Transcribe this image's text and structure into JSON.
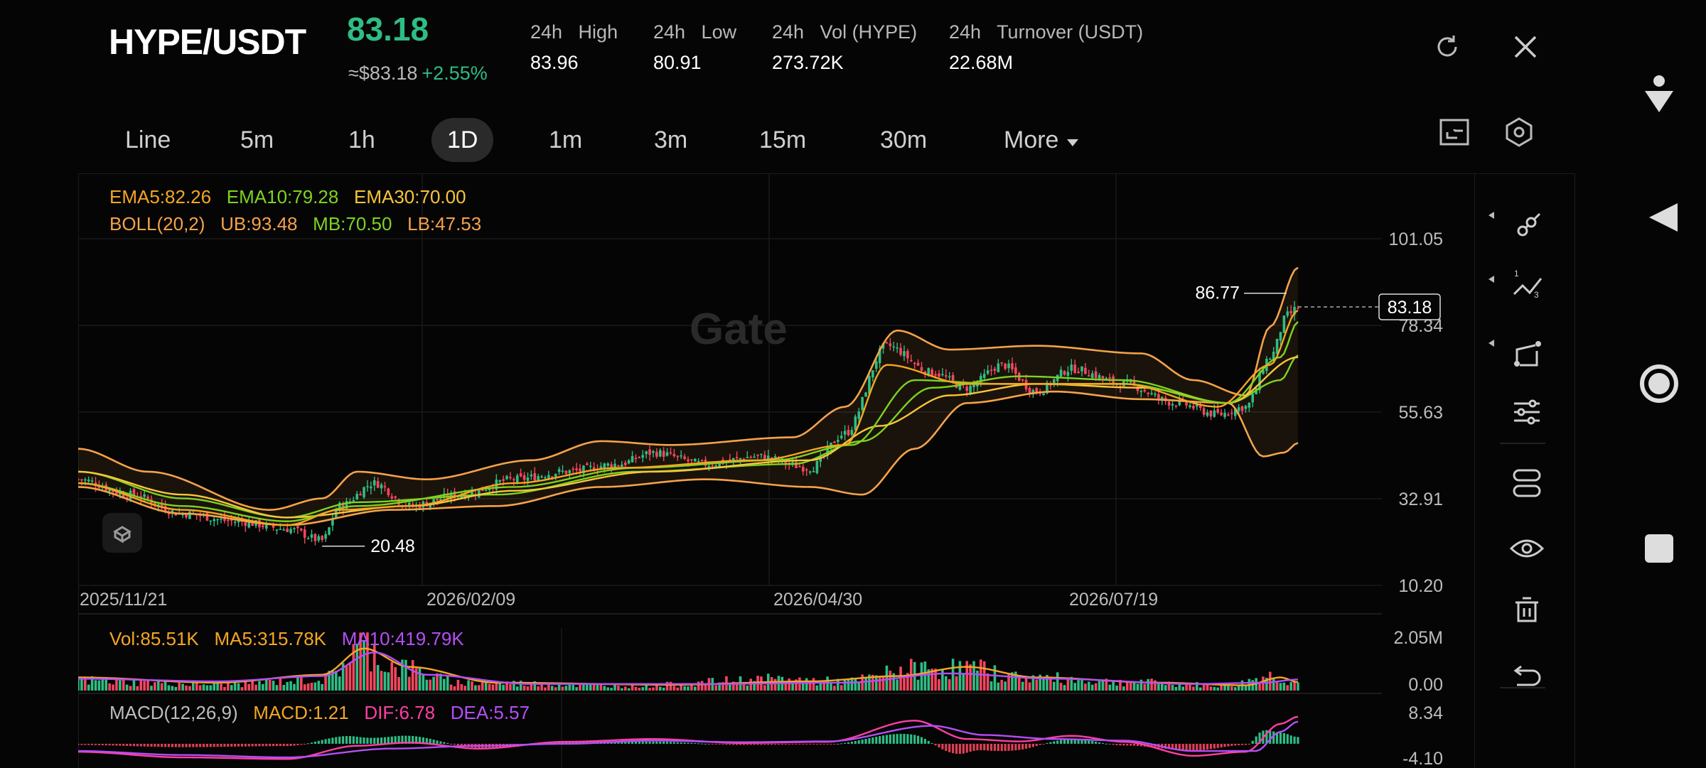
{
  "header": {
    "symbol": "HYPE/USDT",
    "last_price": "83.18",
    "approx_usd": "≈$83.18",
    "change_pct": "+2.55%",
    "stats": [
      {
        "label": "24h   High",
        "value": "83.96"
      },
      {
        "label": "24h   Low",
        "value": "80.91"
      },
      {
        "label": "24h   Vol (HYPE)",
        "value": "273.72K"
      },
      {
        "label": "24h   Turnover (USDT)",
        "value": "22.68M"
      }
    ],
    "icons": {
      "refresh": "refresh-icon",
      "close": "close-icon"
    }
  },
  "timeframes": [
    "Line",
    "5m",
    "1h",
    "1D",
    "1m",
    "3m",
    "15m",
    "30m"
  ],
  "selected_timeframe": "1D",
  "more_label": "More",
  "watermark": "Gate",
  "indicators": {
    "ema": [
      "EMA5:82.26",
      "EMA10:79.28",
      "EMA30:70.00"
    ],
    "boll": [
      "BOLL(20,2)",
      "UB:93.48",
      "MB:70.50",
      "LB:47.53"
    ],
    "vol": [
      "Vol:85.51K",
      "MA5:315.78K",
      "MA10:419.79K"
    ],
    "macd": [
      "MACD(12,26,9)",
      "MACD:1.21",
      "DIF:6.78",
      "DEA:5.57"
    ]
  },
  "colors": {
    "up": "#2ebd85",
    "down": "#f6465d",
    "ema5": "#f5a623",
    "ema10": "#7ed321",
    "ema30": "#f8c53a",
    "boll": "#f5a24a",
    "ma10": "#b44ef7",
    "dif": "#ff3fa4",
    "dea": "#b44ef7"
  },
  "chart_data": [
    {
      "type": "candlestick",
      "title": "HYPE/USDT 1D",
      "x_dates": [
        "2025/11/21",
        "2026/02/09",
        "2026/04/30",
        "2026/07/19"
      ],
      "y_ticks": [
        "101.05",
        "78.34",
        "55.63",
        "32.91",
        "10.20"
      ],
      "ylim": [
        10.2,
        101.05
      ],
      "last_price_label": "83.18",
      "annotations": {
        "high": "86.77",
        "low": "20.48"
      },
      "close_anchors": [
        [
          0,
          38
        ],
        [
          15,
          34
        ],
        [
          30,
          29
        ],
        [
          45,
          27
        ],
        [
          60,
          25
        ],
        [
          70,
          22
        ],
        [
          75,
          31
        ],
        [
          85,
          37
        ],
        [
          95,
          31
        ],
        [
          110,
          34
        ],
        [
          125,
          38
        ],
        [
          140,
          40
        ],
        [
          155,
          42
        ],
        [
          165,
          45
        ],
        [
          180,
          42
        ],
        [
          195,
          44
        ],
        [
          210,
          41
        ],
        [
          220,
          50
        ],
        [
          232,
          73
        ],
        [
          245,
          66
        ],
        [
          255,
          62
        ],
        [
          265,
          68
        ],
        [
          275,
          61
        ],
        [
          285,
          67
        ],
        [
          300,
          63
        ],
        [
          315,
          58
        ],
        [
          327,
          55
        ],
        [
          335,
          57
        ],
        [
          342,
          70
        ],
        [
          347,
          81
        ],
        [
          350,
          83
        ]
      ],
      "ema5": [
        [
          0,
          37
        ],
        [
          30,
          30
        ],
        [
          60,
          26
        ],
        [
          75,
          30
        ],
        [
          95,
          31
        ],
        [
          125,
          37
        ],
        [
          155,
          41
        ],
        [
          195,
          43
        ],
        [
          220,
          47
        ],
        [
          232,
          68
        ],
        [
          255,
          63
        ],
        [
          275,
          63
        ],
        [
          300,
          63
        ],
        [
          327,
          57
        ],
        [
          342,
          68
        ],
        [
          350,
          82.26
        ]
      ],
      "ema10": [
        [
          0,
          37
        ],
        [
          30,
          31
        ],
        [
          60,
          27
        ],
        [
          80,
          31
        ],
        [
          125,
          36
        ],
        [
          160,
          41
        ],
        [
          200,
          43
        ],
        [
          222,
          47
        ],
        [
          240,
          64
        ],
        [
          265,
          63
        ],
        [
          300,
          63
        ],
        [
          330,
          58
        ],
        [
          345,
          70
        ],
        [
          350,
          79.28
        ]
      ],
      "ema30": [
        [
          0,
          40
        ],
        [
          30,
          34
        ],
        [
          60,
          28
        ],
        [
          95,
          31
        ],
        [
          125,
          35
        ],
        [
          165,
          40
        ],
        [
          210,
          43
        ],
        [
          230,
          52
        ],
        [
          250,
          60
        ],
        [
          275,
          63
        ],
        [
          305,
          62
        ],
        [
          330,
          58
        ],
        [
          350,
          70.0
        ]
      ],
      "boll_upper": [
        [
          0,
          46
        ],
        [
          20,
          40
        ],
        [
          55,
          30
        ],
        [
          70,
          33
        ],
        [
          80,
          40
        ],
        [
          100,
          38
        ],
        [
          130,
          43
        ],
        [
          150,
          48
        ],
        [
          170,
          47
        ],
        [
          205,
          49
        ],
        [
          220,
          57
        ],
        [
          235,
          77
        ],
        [
          250,
          72
        ],
        [
          275,
          73
        ],
        [
          305,
          71
        ],
        [
          320,
          64
        ],
        [
          335,
          60
        ],
        [
          342,
          78
        ],
        [
          350,
          93.48
        ]
      ],
      "boll_mid": [
        [
          0,
          40
        ],
        [
          30,
          33
        ],
        [
          60,
          28
        ],
        [
          80,
          32
        ],
        [
          120,
          34
        ],
        [
          160,
          40
        ],
        [
          205,
          42
        ],
        [
          225,
          48
        ],
        [
          245,
          62
        ],
        [
          270,
          65
        ],
        [
          300,
          64
        ],
        [
          330,
          58
        ],
        [
          345,
          64
        ],
        [
          350,
          70.5
        ]
      ],
      "boll_lower": [
        [
          0,
          36
        ],
        [
          30,
          29
        ],
        [
          60,
          26
        ],
        [
          90,
          30
        ],
        [
          120,
          31
        ],
        [
          150,
          36
        ],
        [
          180,
          38
        ],
        [
          210,
          36
        ],
        [
          225,
          34
        ],
        [
          240,
          46
        ],
        [
          255,
          58
        ],
        [
          280,
          61
        ],
        [
          305,
          59
        ],
        [
          330,
          58
        ],
        [
          340,
          44
        ],
        [
          346,
          45
        ],
        [
          350,
          47.53
        ]
      ]
    },
    {
      "type": "bar",
      "title": "Volume",
      "y_ticks": [
        "2.05M",
        "0.00"
      ],
      "ylim": [
        0,
        2.05
      ],
      "unit": "M",
      "volume_anchors": [
        [
          0,
          0.45
        ],
        [
          40,
          0.28
        ],
        [
          70,
          0.5
        ],
        [
          82,
          1.95
        ],
        [
          90,
          1.1
        ],
        [
          110,
          0.35
        ],
        [
          160,
          0.22
        ],
        [
          200,
          0.5
        ],
        [
          220,
          0.4
        ],
        [
          240,
          0.95
        ],
        [
          255,
          1.0
        ],
        [
          270,
          0.6
        ],
        [
          300,
          0.38
        ],
        [
          330,
          0.22
        ],
        [
          342,
          0.65
        ],
        [
          350,
          0.33
        ]
      ],
      "ma5_anchors": [
        [
          0,
          0.5
        ],
        [
          40,
          0.3
        ],
        [
          70,
          0.6
        ],
        [
          82,
          1.6
        ],
        [
          95,
          0.9
        ],
        [
          120,
          0.3
        ],
        [
          170,
          0.22
        ],
        [
          210,
          0.35
        ],
        [
          235,
          0.55
        ],
        [
          255,
          0.9
        ],
        [
          275,
          0.5
        ],
        [
          310,
          0.3
        ],
        [
          335,
          0.2
        ],
        [
          345,
          0.5
        ],
        [
          350,
          0.32
        ]
      ],
      "ma10_anchors": [
        [
          0,
          0.45
        ],
        [
          40,
          0.35
        ],
        [
          70,
          0.55
        ],
        [
          85,
          1.45
        ],
        [
          100,
          0.6
        ],
        [
          130,
          0.25
        ],
        [
          180,
          0.25
        ],
        [
          220,
          0.3
        ],
        [
          250,
          0.65
        ],
        [
          280,
          0.45
        ],
        [
          320,
          0.25
        ],
        [
          340,
          0.3
        ],
        [
          350,
          0.42
        ]
      ]
    },
    {
      "type": "bar",
      "title": "MACD",
      "y_ticks": [
        "8.34",
        "-4.10"
      ],
      "ylim": [
        -4.1,
        8.34
      ],
      "dif_anchors": [
        [
          0,
          -2
        ],
        [
          30,
          -3.4
        ],
        [
          60,
          -3.8
        ],
        [
          80,
          -0.5
        ],
        [
          95,
          0.3
        ],
        [
          115,
          -1.2
        ],
        [
          140,
          0.5
        ],
        [
          165,
          1.2
        ],
        [
          190,
          0.2
        ],
        [
          215,
          0.5
        ],
        [
          240,
          5.8
        ],
        [
          255,
          1.2
        ],
        [
          270,
          0.6
        ],
        [
          285,
          2
        ],
        [
          300,
          0.5
        ],
        [
          320,
          -3
        ],
        [
          335,
          -2
        ],
        [
          345,
          5
        ],
        [
          350,
          6.78
        ]
      ],
      "dea_anchors": [
        [
          0,
          -1.8
        ],
        [
          30,
          -2.8
        ],
        [
          60,
          -3.4
        ],
        [
          90,
          -1.2
        ],
        [
          115,
          -0.5
        ],
        [
          140,
          0
        ],
        [
          165,
          0.8
        ],
        [
          190,
          0.4
        ],
        [
          215,
          0.6
        ],
        [
          245,
          4.5
        ],
        [
          260,
          2.2
        ],
        [
          280,
          1.2
        ],
        [
          300,
          0.8
        ],
        [
          320,
          -1.8
        ],
        [
          338,
          -1.8
        ],
        [
          345,
          3
        ],
        [
          350,
          5.57
        ]
      ]
    }
  ],
  "side_tools": [
    "trend-line-icon",
    "fib-icon",
    "shape-icon",
    "adjust-icon",
    "indicator-icon",
    "eye-icon",
    "trash-icon",
    "undo-icon"
  ]
}
